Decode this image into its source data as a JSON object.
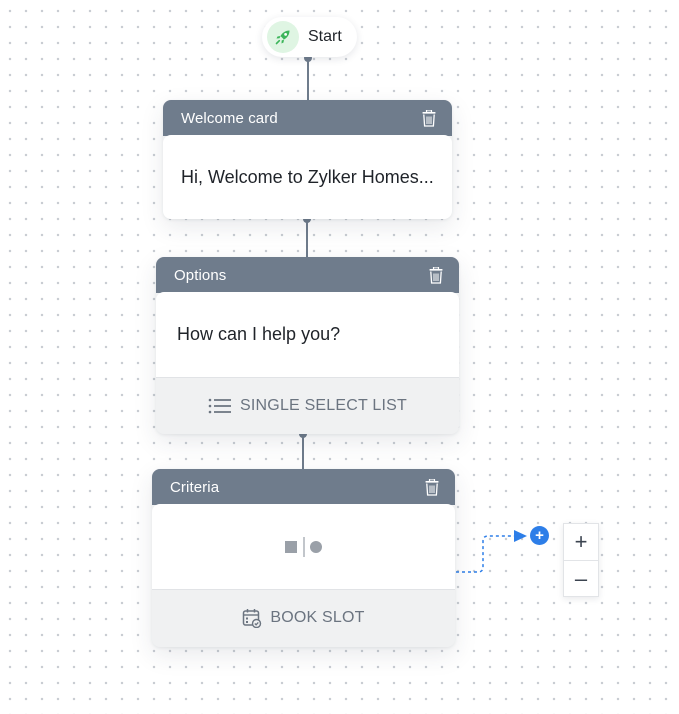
{
  "start": {
    "label": "Start",
    "icon": "rocket-icon"
  },
  "cards": {
    "welcome": {
      "title": "Welcome card",
      "message": "Hi, Welcome to Zylker Homes..."
    },
    "options": {
      "title": "Options",
      "message": "How can I help you?",
      "footer_label": "SINGLE SELECT LIST",
      "footer_icon": "list-icon"
    },
    "criteria": {
      "title": "Criteria",
      "body_icon": "criteria-icon",
      "footer_label": "BOOK SLOT",
      "footer_icon": "calendar-check-icon"
    }
  },
  "zoom": {
    "in_label": "+",
    "out_label": "–"
  },
  "add_node_label": "+",
  "colors": {
    "header": "#6f7c8c",
    "connector": "#6f7c8c",
    "accent_blue": "#2d7ee8",
    "start_icon_bg": "#dff5e3",
    "start_icon_fg": "#3cb55a"
  }
}
